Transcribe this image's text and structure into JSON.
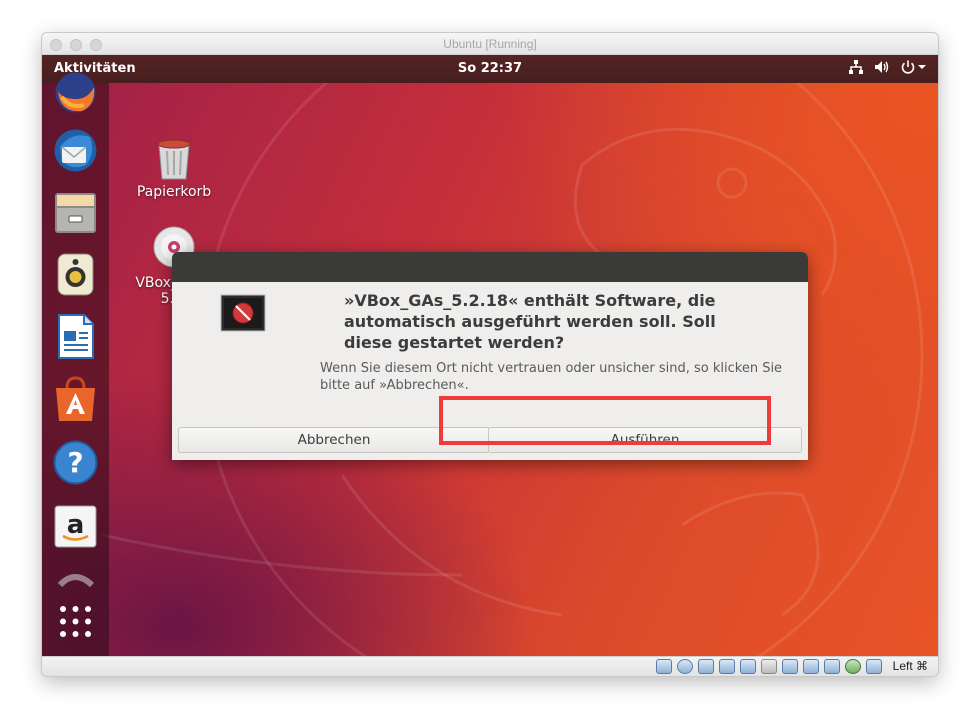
{
  "window": {
    "title": "Ubuntu [Running]"
  },
  "topbar": {
    "activities": "Aktivitäten",
    "clock": "So 22:37"
  },
  "dock": {
    "items": [
      "firefox-icon",
      "thunderbird-icon",
      "files-icon",
      "rhythmbox-icon",
      "writer-icon",
      "software-icon",
      "help-icon",
      "amazon-icon",
      "software-update-icon",
      "show-apps-icon"
    ]
  },
  "desktop": {
    "trash_label": "Papierkorb",
    "cd_label_line1": "VBox_GAs_",
    "cd_label_line2": "5.2."
  },
  "dialog": {
    "title": "»VBox_GAs_5.2.18« enthält Software, die automatisch ausgeführt werden soll. Soll diese gestartet werden?",
    "body": "Wenn Sie diesem Ort nicht vertrauen oder unsicher sind, so klicken Sie bitte auf »Abbrechen«.",
    "cancel_label": "Abbrechen",
    "run_label": "Ausführen"
  },
  "statusbar": {
    "host_key": "Left ⌘"
  },
  "colors": {
    "highlight": "#ee3b3b",
    "topbar": "#4d2121",
    "ubuntu_orange": "#e95420"
  }
}
